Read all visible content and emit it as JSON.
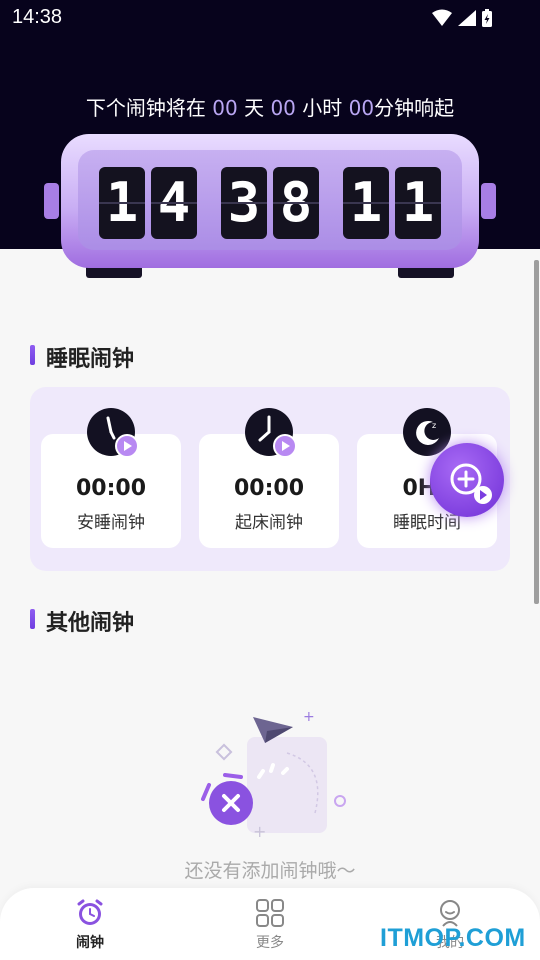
{
  "status_bar": {
    "time": "14:38",
    "icons": [
      "wifi-icon",
      "signal-icon",
      "battery-charging-icon"
    ]
  },
  "next_alarm": {
    "prefix": "下个闹钟将在 ",
    "days": "00",
    "days_unit": " 天 ",
    "hours": "00",
    "hours_unit": " 小时 ",
    "minutes": "00",
    "minutes_unit": "分钟响起"
  },
  "clock": {
    "digits": [
      "1",
      "4",
      "3",
      "8",
      "1",
      "1"
    ]
  },
  "sleep_section": {
    "title": "睡眠闹钟",
    "cards": [
      {
        "value": "00:00",
        "label": "安睡闹钟",
        "icon": "clock-play-icon"
      },
      {
        "value": "00:00",
        "label": "起床闹钟",
        "icon": "clock-play-icon"
      },
      {
        "value": "0H0",
        "label": "睡眠时间",
        "icon": "moon-sleep-icon"
      }
    ]
  },
  "other_section": {
    "title": "其他闹钟",
    "empty_text": "还没有添加闹钟哦～"
  },
  "fab": {
    "icon": "add-alarm-icon"
  },
  "nav": [
    {
      "label": "闹钟",
      "icon": "alarm-clock-icon",
      "active": true
    },
    {
      "label": "更多",
      "icon": "grid-icon",
      "active": false
    },
    {
      "label": "我的",
      "icon": "profile-icon",
      "active": false
    }
  ],
  "watermark": "ITMOP.COM",
  "colors": {
    "accent": "#7b4ae6",
    "hero_bg": "#07031c",
    "highlight_num": "#b9a6f2"
  }
}
